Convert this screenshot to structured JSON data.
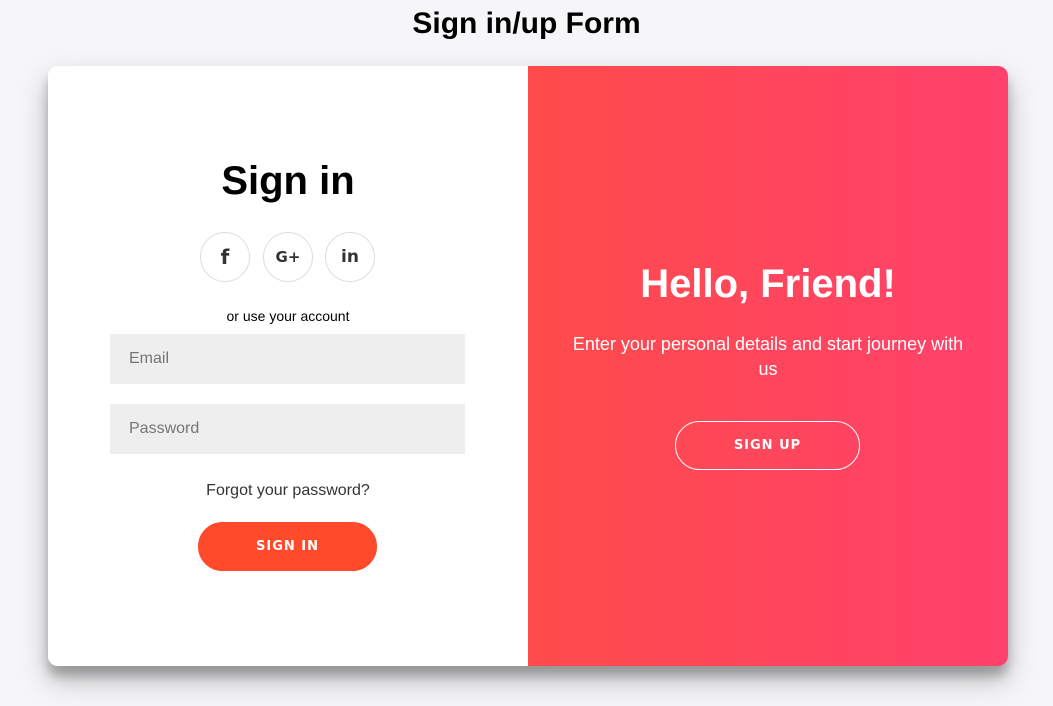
{
  "page": {
    "title": "Sign in/up Form"
  },
  "signin": {
    "heading": "Sign in",
    "social": {
      "facebook": "f",
      "google": "G+",
      "linkedin": "in"
    },
    "alt_text": "or use your account",
    "email_placeholder": "Email",
    "password_placeholder": "Password",
    "forgot_link": "Forgot your password?",
    "button_label": "SIGN IN"
  },
  "overlay": {
    "heading": "Hello, Friend!",
    "text": "Enter your personal details and start journey with us",
    "button_label": "SIGN UP"
  },
  "colors": {
    "accent": "#ff4b2b",
    "gradient_start": "#ff4b4b",
    "gradient_end": "#ff416c",
    "background": "#f6f5f7",
    "input_bg": "#eeeeee"
  },
  "icons": [
    "facebook-icon",
    "google-plus-icon",
    "linkedin-icon"
  ]
}
